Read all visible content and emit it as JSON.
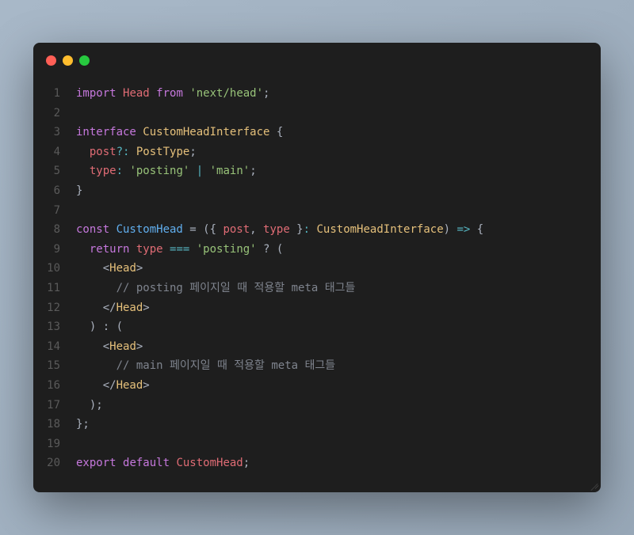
{
  "titlebar": {
    "dots": [
      "red",
      "yellow",
      "green"
    ]
  },
  "lines": [
    {
      "n": "1",
      "tokens": [
        {
          "t": "import ",
          "c": "k-import"
        },
        {
          "t": "Head",
          "c": "ident"
        },
        {
          "t": " from ",
          "c": "k-from"
        },
        {
          "t": "'next/head'",
          "c": "str"
        },
        {
          "t": ";",
          "c": "punct"
        }
      ]
    },
    {
      "n": "2",
      "tokens": []
    },
    {
      "n": "3",
      "tokens": [
        {
          "t": "interface ",
          "c": "k-interface"
        },
        {
          "t": "CustomHeadInterface",
          "c": "typename"
        },
        {
          "t": " {",
          "c": "punct"
        }
      ]
    },
    {
      "n": "4",
      "tokens": [
        {
          "t": "  ",
          "c": "punct"
        },
        {
          "t": "post",
          "c": "prop"
        },
        {
          "t": "?:",
          "c": "op"
        },
        {
          "t": " ",
          "c": "punct"
        },
        {
          "t": "PostType",
          "c": "typename"
        },
        {
          "t": ";",
          "c": "punct"
        }
      ]
    },
    {
      "n": "5",
      "tokens": [
        {
          "t": "  ",
          "c": "punct"
        },
        {
          "t": "type",
          "c": "prop"
        },
        {
          "t": ":",
          "c": "op"
        },
        {
          "t": " ",
          "c": "punct"
        },
        {
          "t": "'posting'",
          "c": "str"
        },
        {
          "t": " | ",
          "c": "op"
        },
        {
          "t": "'main'",
          "c": "str"
        },
        {
          "t": ";",
          "c": "punct"
        }
      ]
    },
    {
      "n": "6",
      "tokens": [
        {
          "t": "}",
          "c": "punct"
        }
      ]
    },
    {
      "n": "7",
      "tokens": []
    },
    {
      "n": "8",
      "tokens": [
        {
          "t": "const ",
          "c": "k-const"
        },
        {
          "t": "CustomHead",
          "c": "func"
        },
        {
          "t": " = ({ ",
          "c": "punct"
        },
        {
          "t": "post",
          "c": "ident"
        },
        {
          "t": ", ",
          "c": "punct"
        },
        {
          "t": "type",
          "c": "ident"
        },
        {
          "t": " }",
          "c": "punct"
        },
        {
          "t": ":",
          "c": "op"
        },
        {
          "t": " ",
          "c": "punct"
        },
        {
          "t": "CustomHeadInterface",
          "c": "typename"
        },
        {
          "t": ") ",
          "c": "punct"
        },
        {
          "t": "=>",
          "c": "op"
        },
        {
          "t": " {",
          "c": "punct"
        }
      ]
    },
    {
      "n": "9",
      "tokens": [
        {
          "t": "  ",
          "c": "punct"
        },
        {
          "t": "return ",
          "c": "k-return"
        },
        {
          "t": "type",
          "c": "ident"
        },
        {
          "t": " === ",
          "c": "op"
        },
        {
          "t": "'posting'",
          "c": "str"
        },
        {
          "t": " ? (",
          "c": "punct"
        }
      ]
    },
    {
      "n": "10",
      "tokens": [
        {
          "t": "    ",
          "c": "punct"
        },
        {
          "t": "<",
          "c": "tagb"
        },
        {
          "t": "Head",
          "c": "typename"
        },
        {
          "t": ">",
          "c": "tagb"
        }
      ]
    },
    {
      "n": "11",
      "tokens": [
        {
          "t": "      ",
          "c": "punct"
        },
        {
          "t": "// posting 페이지일 때 적용할 meta 태그들",
          "c": "comment"
        }
      ]
    },
    {
      "n": "12",
      "tokens": [
        {
          "t": "    ",
          "c": "punct"
        },
        {
          "t": "</",
          "c": "tagb"
        },
        {
          "t": "Head",
          "c": "typename"
        },
        {
          "t": ">",
          "c": "tagb"
        }
      ]
    },
    {
      "n": "13",
      "tokens": [
        {
          "t": "  ) : (",
          "c": "punct"
        }
      ]
    },
    {
      "n": "14",
      "tokens": [
        {
          "t": "    ",
          "c": "punct"
        },
        {
          "t": "<",
          "c": "tagb"
        },
        {
          "t": "Head",
          "c": "typename"
        },
        {
          "t": ">",
          "c": "tagb"
        }
      ]
    },
    {
      "n": "15",
      "tokens": [
        {
          "t": "      ",
          "c": "punct"
        },
        {
          "t": "// main 페이지일 때 적용할 meta 태그들",
          "c": "comment"
        }
      ]
    },
    {
      "n": "16",
      "tokens": [
        {
          "t": "    ",
          "c": "punct"
        },
        {
          "t": "</",
          "c": "tagb"
        },
        {
          "t": "Head",
          "c": "typename"
        },
        {
          "t": ">",
          "c": "tagb"
        }
      ]
    },
    {
      "n": "17",
      "tokens": [
        {
          "t": "  );",
          "c": "punct"
        }
      ]
    },
    {
      "n": "18",
      "tokens": [
        {
          "t": "};",
          "c": "punct"
        }
      ]
    },
    {
      "n": "19",
      "tokens": []
    },
    {
      "n": "20",
      "tokens": [
        {
          "t": "export ",
          "c": "k-export"
        },
        {
          "t": "default ",
          "c": "k-default"
        },
        {
          "t": "CustomHead",
          "c": "ident"
        },
        {
          "t": ";",
          "c": "punct"
        }
      ]
    }
  ]
}
